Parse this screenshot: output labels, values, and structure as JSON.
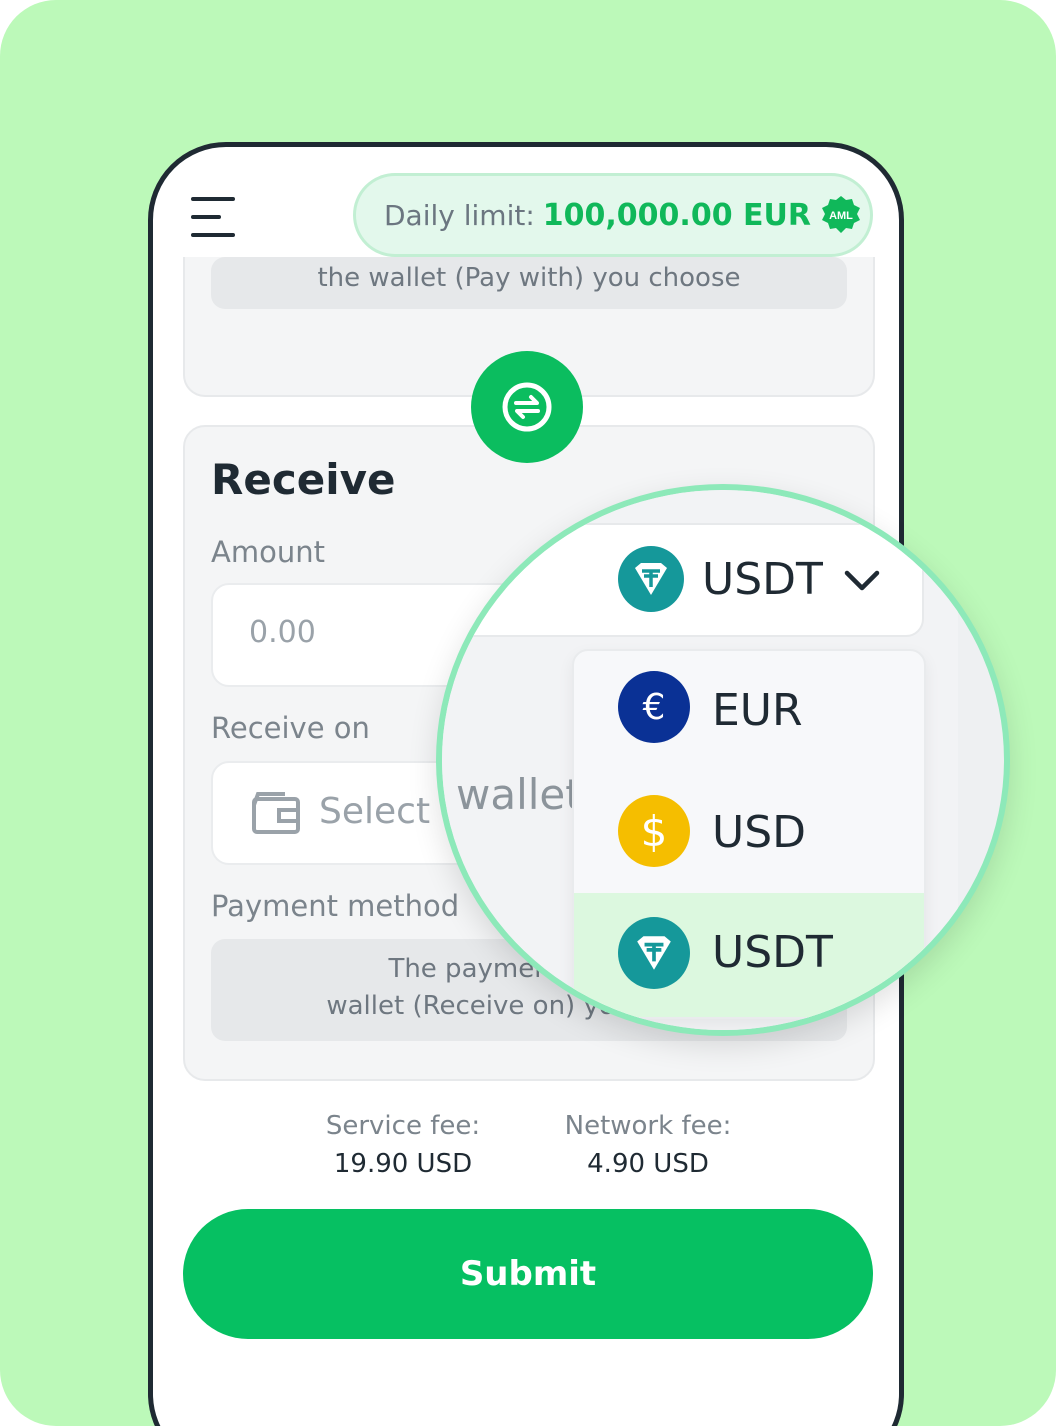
{
  "header": {
    "daily_limit_label": "Daily limit:",
    "daily_limit_value": "100,000.00 EUR",
    "aml_badge": "AML"
  },
  "pay_section": {
    "note": "the wallet (Pay with) you choose"
  },
  "receive": {
    "title": "Receive",
    "amount_label": "Amount",
    "amount_placeholder": "0.00",
    "currency_selected": "USDT",
    "receive_on_label": "Receive on",
    "select_wallet_placeholder": "Select wallet",
    "payment_method_label": "Payment method",
    "payment_method_note_line1": "The payment method",
    "payment_method_note_line2": "wallet (Receive on) you choose"
  },
  "currency_dropdown": {
    "options": [
      {
        "code": "EUR",
        "icon": "euro-icon",
        "color": "#0a3195"
      },
      {
        "code": "USD",
        "icon": "dollar-icon",
        "color": "#f5be00"
      },
      {
        "code": "USDT",
        "icon": "tether-icon",
        "color": "#15989a"
      }
    ],
    "selected": "USDT"
  },
  "fees": {
    "service_fee_label": "Service fee:",
    "service_fee_value": "19.90 USD",
    "network_fee_label": "Network fee:",
    "network_fee_value": "4.90 USD"
  },
  "actions": {
    "submit_label": "Submit"
  },
  "colors": {
    "accent": "#06c062",
    "background": "#bcf9b9"
  }
}
